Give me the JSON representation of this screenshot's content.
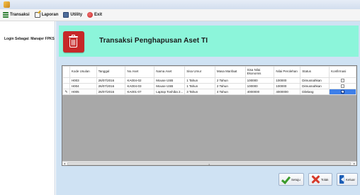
{
  "menu": {
    "items": [
      {
        "label": "Transaksi",
        "icon": "list-icon"
      },
      {
        "label": "Laporan",
        "icon": "edit-icon"
      },
      {
        "label": "Utility",
        "icon": "utility-icon"
      },
      {
        "label": "Exit",
        "icon": "exit-icon"
      }
    ]
  },
  "sidebar": {
    "login_text": "Login Sebagai: Manajer FPKS"
  },
  "banner": {
    "title": "Transaksi Penghapusan Aset TI",
    "icon": "trash-bin-icon",
    "background": "#8cf5da",
    "icon_color": "#c62828"
  },
  "grid": {
    "columns": [
      "Kode Usulan",
      "Tanggal",
      "No Aset",
      "Nama Aset",
      "Sisa Umur",
      "Masa Manfaat",
      "Sisa Nilai Ekonomis",
      "Nilai Perolehan",
      "Status",
      "Konfirmasi"
    ],
    "rows": [
      [
        "H003",
        "26/07/2016",
        "KA004-02",
        "Mouse USB",
        "1 Tahun",
        "2 Tahun",
        "100000",
        "100000",
        "Dimusnahkan",
        false
      ],
      [
        "H004",
        "26/07/2016",
        "KA004-03",
        "Mouse USB",
        "1 Tahun",
        "2 Tahun",
        "100000",
        "100000",
        "Dimusnahkan",
        false
      ],
      [
        "H005",
        "26/07/2016",
        "KA001-07",
        "Laptop Toshiba 2...",
        "3 Tahun",
        "4 Tahun",
        "4000000",
        "4000000",
        "Dilelang",
        true
      ]
    ],
    "selection_color": "#3d7ee8"
  },
  "buttons": {
    "setuju": "Setuju",
    "tolak": "Tolak",
    "keluar": "Keluar"
  }
}
